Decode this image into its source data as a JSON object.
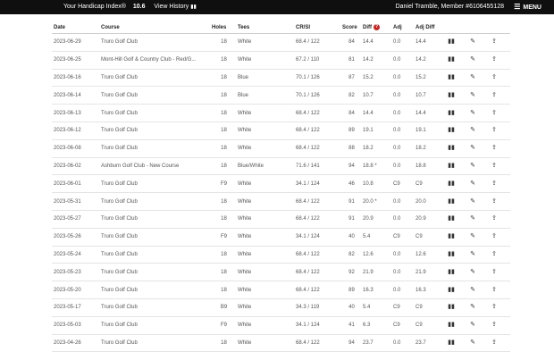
{
  "topbar": {
    "handicap_label": "Your Handicap Index®",
    "handicap_value": "10.6",
    "history_label": "View History",
    "history_icon": "bar-chart-icon",
    "member_text": "Daniel Tramble, Member #6106455128",
    "menu_label": "MENU",
    "menu_icon": "hamburger-icon"
  },
  "table": {
    "headers": [
      "Date",
      "Course",
      "Holes",
      "Tees",
      "CR/SI",
      "Score",
      "Diff",
      "Adj",
      "Adj Diff"
    ],
    "row_icons": [
      "chart-icon",
      "edit-icon",
      "share-icon"
    ],
    "rows": [
      {
        "date": "2023-06-29",
        "course": "Truro Golf Club",
        "holes": "18",
        "tees": "White",
        "cr": "68.4 / 122",
        "score": "84",
        "diff": "14.4",
        "adj": "0.0",
        "adj_diff": "14.4"
      },
      {
        "date": "2023-06-25",
        "course": "Mont-Hill Golf & Country Club - Red/G...",
        "holes": "18",
        "tees": "White",
        "cr": "67.2 / 110",
        "score": "81",
        "diff": "14.2",
        "adj": "0.0",
        "adj_diff": "14.2"
      },
      {
        "date": "2023-06-16",
        "course": "Truro Golf Club",
        "holes": "18",
        "tees": "Blue",
        "cr": "70.1 / 126",
        "score": "87",
        "diff": "15.2",
        "adj": "0.0",
        "adj_diff": "15.2"
      },
      {
        "date": "2023-06-14",
        "course": "Truro Golf Club",
        "holes": "18",
        "tees": "Blue",
        "cr": "70.1 / 126",
        "score": "82",
        "diff": "10.7",
        "adj": "0.0",
        "adj_diff": "10.7"
      },
      {
        "date": "2023-06-13",
        "course": "Truro Golf Club",
        "holes": "18",
        "tees": "White",
        "cr": "68.4 / 122",
        "score": "84",
        "diff": "14.4",
        "adj": "0.0",
        "adj_diff": "14.4"
      },
      {
        "date": "2023-06-12",
        "course": "Truro Golf Club",
        "holes": "18",
        "tees": "White",
        "cr": "68.4 / 122",
        "score": "89",
        "diff": "19.1",
        "adj": "0.0",
        "adj_diff": "19.1"
      },
      {
        "date": "2023-06-08",
        "course": "Truro Golf Club",
        "holes": "18",
        "tees": "White",
        "cr": "68.4 / 122",
        "score": "88",
        "diff": "18.2",
        "adj": "0.0",
        "adj_diff": "18.2"
      },
      {
        "date": "2023-06-02",
        "course": "Ashburn Golf Club - New Course",
        "holes": "18",
        "tees": "Blue/White",
        "cr": "71.6 / 141",
        "score": "94",
        "diff": "18.8 *",
        "adj": "0.0",
        "adj_diff": "18.8"
      },
      {
        "date": "2023-06-01",
        "course": "Truro Golf Club",
        "holes": "F9",
        "tees": "White",
        "cr": "34.1 / 124",
        "score": "46",
        "diff": "10.8",
        "adj": "C9",
        "adj_diff": "C9"
      },
      {
        "date": "2023-05-31",
        "course": "Truro Golf Club",
        "holes": "18",
        "tees": "White",
        "cr": "68.4 / 122",
        "score": "91",
        "diff": "20.0 *",
        "adj": "0.0",
        "adj_diff": "20.0"
      },
      {
        "date": "2023-05-27",
        "course": "Truro Golf Club",
        "holes": "18",
        "tees": "White",
        "cr": "68.4 / 122",
        "score": "91",
        "diff": "20.9",
        "adj": "0.0",
        "adj_diff": "20.9"
      },
      {
        "date": "2023-05-26",
        "course": "Truro Golf Club",
        "holes": "F9",
        "tees": "White",
        "cr": "34.1 / 124",
        "score": "40",
        "diff": "5.4",
        "adj": "C9",
        "adj_diff": "C9"
      },
      {
        "date": "2023-05-24",
        "course": "Truro Golf Club",
        "holes": "18",
        "tees": "White",
        "cr": "68.4 / 122",
        "score": "82",
        "diff": "12.6",
        "adj": "0.0",
        "adj_diff": "12.6"
      },
      {
        "date": "2023-05-23",
        "course": "Truro Golf Club",
        "holes": "18",
        "tees": "White",
        "cr": "68.4 / 122",
        "score": "92",
        "diff": "21.9",
        "adj": "0.0",
        "adj_diff": "21.9"
      },
      {
        "date": "2023-05-20",
        "course": "Truro Golf Club",
        "holes": "18",
        "tees": "White",
        "cr": "68.4 / 122",
        "score": "89",
        "diff": "16.3",
        "adj": "0.0",
        "adj_diff": "16.3"
      },
      {
        "date": "2023-05-17",
        "course": "Truro Golf Club",
        "holes": "B9",
        "tees": "White",
        "cr": "34.3 / 119",
        "score": "40",
        "diff": "5.4",
        "adj": "C9",
        "adj_diff": "C9"
      },
      {
        "date": "2023-05-03",
        "course": "Truro Golf Club",
        "holes": "F9",
        "tees": "White",
        "cr": "34.1 / 124",
        "score": "41",
        "diff": "6.3",
        "adj": "C9",
        "adj_diff": "C9"
      },
      {
        "date": "2023-04-26",
        "course": "Truro Golf Club",
        "holes": "18",
        "tees": "White",
        "cr": "68.4 / 122",
        "score": "94",
        "diff": "23.7",
        "adj": "0.0",
        "adj_diff": "23.7"
      }
    ]
  }
}
